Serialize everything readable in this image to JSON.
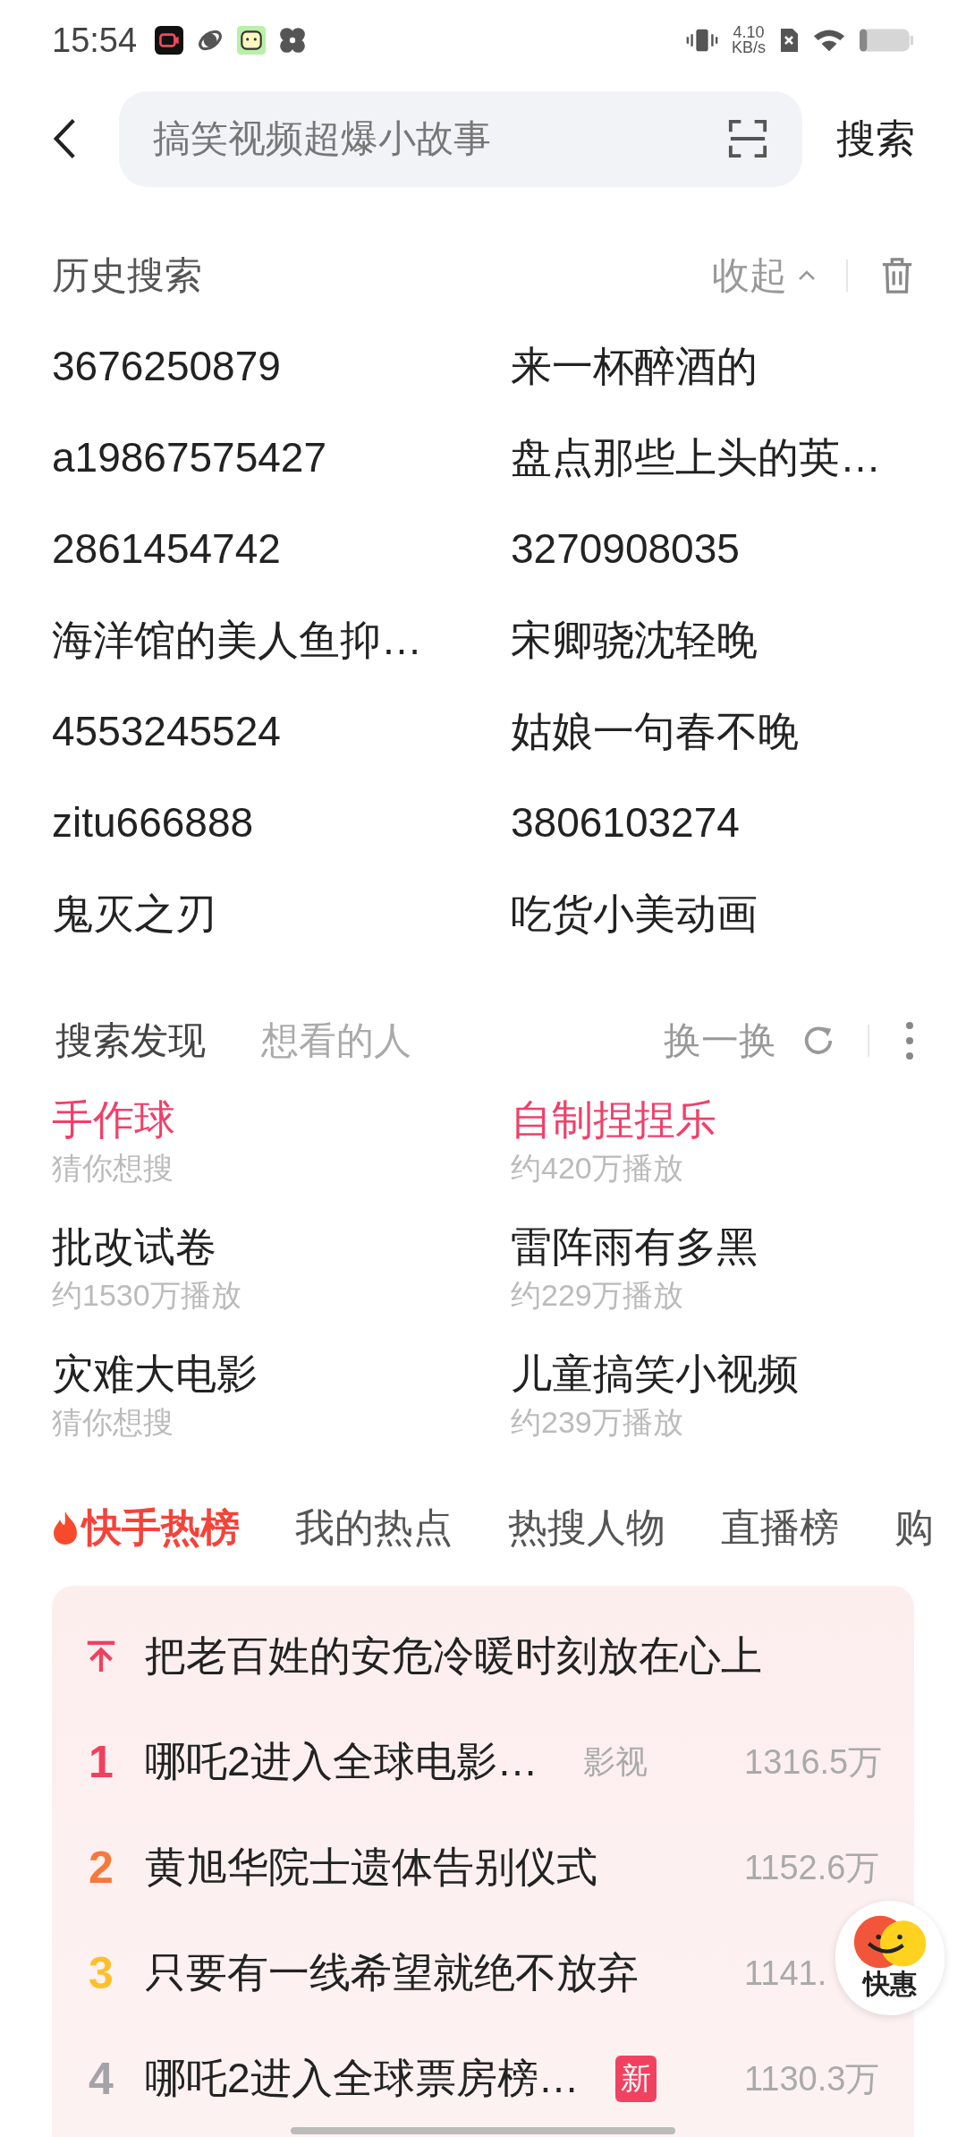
{
  "status_bar": {
    "time": "15:54",
    "net_speed": "4.10",
    "net_unit": "KB/s"
  },
  "search": {
    "placeholder": "搞笑视频超爆小故事",
    "button": "搜索"
  },
  "history": {
    "title": "历史搜索",
    "collapse": "收起",
    "items": [
      {
        "text": "3676250879"
      },
      {
        "text": "来一杯醉酒的"
      },
      {
        "text": "a19867575427"
      },
      {
        "text": "盘点那些上头的英…"
      },
      {
        "text": "2861454742"
      },
      {
        "text": "3270908035"
      },
      {
        "text": "海洋馆的美人鱼抑…"
      },
      {
        "text": "宋卿骁沈轻晚"
      },
      {
        "text": "4553245524"
      },
      {
        "text": "姑娘一句春不晚"
      },
      {
        "text": "zitu666888"
      },
      {
        "text": "3806103274"
      },
      {
        "text": "鬼灭之刃"
      },
      {
        "text": "吃货小美动画"
      }
    ]
  },
  "discover": {
    "tabs": [
      {
        "label": "搜索发现",
        "selected": true
      },
      {
        "label": "想看的人",
        "selected": false
      }
    ],
    "refresh": "换一换",
    "items": [
      {
        "title": "手作球",
        "sub": "猜你想搜",
        "highlight": true
      },
      {
        "title": "自制捏捏乐",
        "sub": "约420万播放",
        "highlight": true
      },
      {
        "title": "批改试卷",
        "sub": "约1530万播放",
        "highlight": false
      },
      {
        "title": "雷阵雨有多黑",
        "sub": "约229万播放",
        "highlight": false
      },
      {
        "title": "灾难大电影",
        "sub": "猜你想搜",
        "highlight": false
      },
      {
        "title": "儿童搞笑小视频",
        "sub": "约239万播放",
        "highlight": false
      }
    ]
  },
  "hot": {
    "tabs": [
      {
        "label": "快手热榜",
        "selected": true
      },
      {
        "label": "我的热点",
        "selected": false
      },
      {
        "label": "热搜人物",
        "selected": false
      },
      {
        "label": "直播榜",
        "selected": false
      },
      {
        "label": "购",
        "selected": false
      }
    ],
    "rows": [
      {
        "kind": "pinned",
        "title": "把老百姓的安危冷暖时刻放在心上",
        "color": "#f0405e"
      },
      {
        "kind": "ranked",
        "rank": "1",
        "title": "哪吒2进入全球电影…",
        "tag": {
          "kind": "label",
          "text": "影视"
        },
        "count": "1316.5万",
        "color": "#f0405e"
      },
      {
        "kind": "ranked",
        "rank": "2",
        "title": "黄旭华院士遗体告别仪式",
        "count": "1152.6万",
        "color": "#f5793a"
      },
      {
        "kind": "ranked",
        "rank": "3",
        "title": "只要有一线希望就绝不放弃",
        "count": "1141.",
        "color": "#fbc02d"
      },
      {
        "kind": "ranked",
        "rank": "4",
        "title": "哪吒2进入全球票房榜…",
        "tag": {
          "kind": "new",
          "text": "新"
        },
        "count": "1130.3万",
        "color": "#a3a3a8"
      }
    ]
  },
  "float_badge": {
    "label": "快惠"
  }
}
